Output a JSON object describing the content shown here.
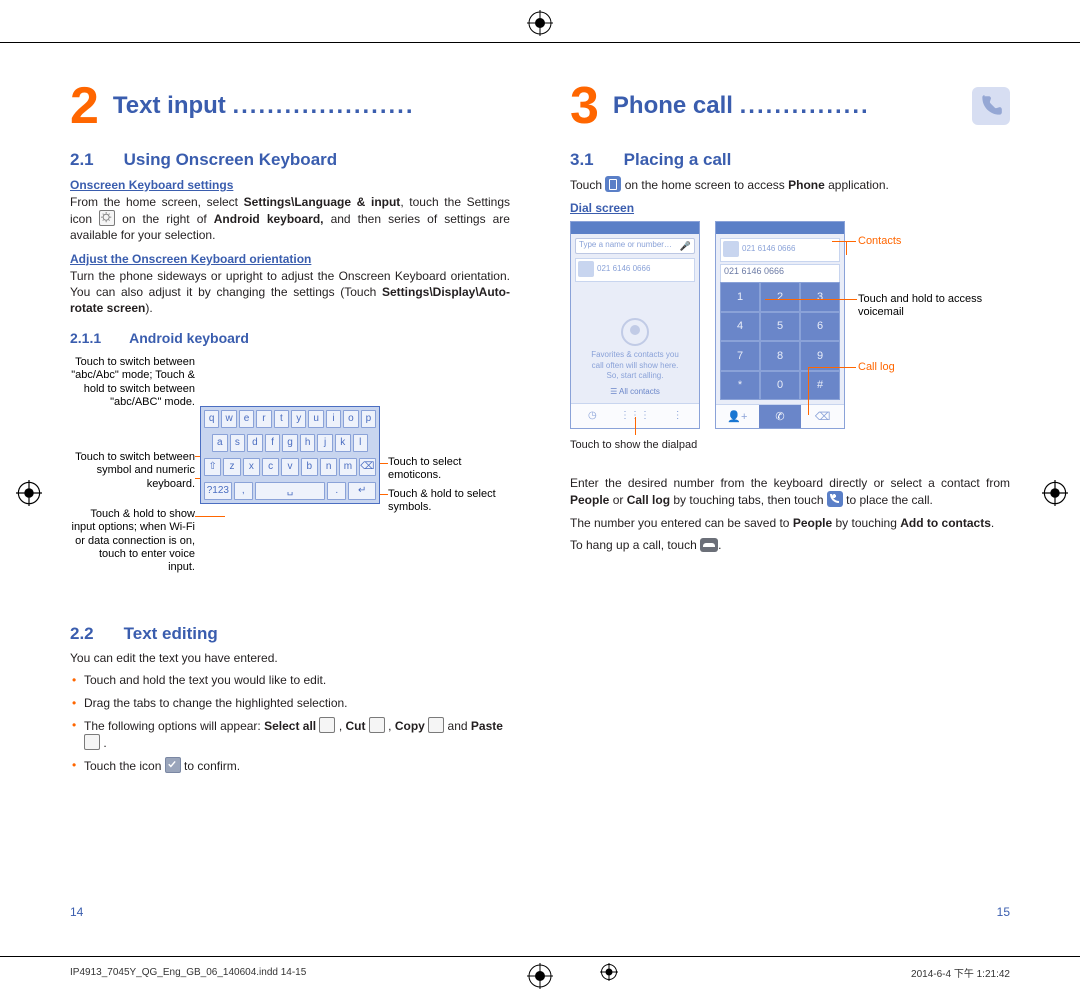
{
  "left": {
    "chapter_num": "2",
    "chapter_title": "Text input",
    "h21_num": "2.1",
    "h21_title": "Using Onscreen Keyboard",
    "sub1": "Onscreen Keyboard settings",
    "p1a": "From the home screen, select ",
    "p1b": "Settings\\Language & input",
    "p1c": ", touch the Settings icon ",
    "p1d": " on the right of ",
    "p1e": "Android keyboard,",
    "p1f": " and then series of settings are available for your selection.",
    "sub2": "Adjust the Onscreen Keyboard orientation",
    "p2a": "Turn the phone sideways or upright to adjust the Onscreen Keyboard orientation. You can also adjust it by changing the settings (Touch ",
    "p2b": "Settings\\Display\\Auto-rotate screen",
    "p2c": ").",
    "h211_num": "2.1.1",
    "h211_title": "Android keyboard",
    "kb_l1": "Touch to switch between \"abc/Abc\" mode; Touch & hold to switch between \"abc/ABC\" mode.",
    "kb_l2": "Touch to switch between symbol and numeric keyboard.",
    "kb_l3": "Touch & hold to show input options; when Wi-Fi or data connection is on, touch to enter voice input.",
    "kb_r1": "Touch to select emoticons.",
    "kb_r2": "Touch & hold to select symbols.",
    "kb_rows": [
      [
        "q",
        "w",
        "e",
        "r",
        "t",
        "y",
        "u",
        "i",
        "o",
        "p"
      ],
      [
        "a",
        "s",
        "d",
        "f",
        "g",
        "h",
        "j",
        "k",
        "l"
      ],
      [
        "⇧",
        "z",
        "x",
        "c",
        "v",
        "b",
        "n",
        "m",
        "⌫"
      ],
      [
        "?123",
        ",",
        "␣",
        ".",
        "↵"
      ]
    ],
    "h22_num": "2.2",
    "h22_title": "Text editing",
    "p3": "You can edit the text you have entered.",
    "b1": "Touch and hold the text you would like to edit.",
    "b2": "Drag the tabs to change the highlighted selection.",
    "b3a": "The following options will appear: ",
    "b3b": "Select all",
    "b3c": " , ",
    "b3d": "Cut",
    "b3e": " , ",
    "b3f": "Copy",
    "b3g": " and ",
    "b3h": "Paste",
    "b3i": " .",
    "b4a": "Touch the icon ",
    "b4b": " to confirm.",
    "pagenum": "14"
  },
  "right": {
    "chapter_num": "3",
    "chapter_title": "Phone call",
    "h31_num": "3.1",
    "h31_title": "Placing a call",
    "p1a": "Touch ",
    "p1b": " on the home screen to access ",
    "p1c": "Phone",
    "p1d": " application.",
    "sub1": "Dial screen",
    "lbl_contacts": "Contacts",
    "lbl_voicemail": "Touch and hold to access voicemail",
    "lbl_calllog": "Call log",
    "lbl_dialpad": "Touch to show the dialpad",
    "search_ph": "Type a name or number…",
    "contact_num": "021 6146 0666",
    "fav_text1": "Favorites & contacts you",
    "fav_text2": "call often will show here.",
    "fav_text3": "So, start calling.",
    "all_contacts": "All contacts",
    "keys": [
      "1",
      "2",
      "3",
      "4",
      "5",
      "6",
      "7",
      "8",
      "9",
      "*",
      "0",
      "#"
    ],
    "p2a": "Enter the desired number from the keyboard directly or select a contact from ",
    "p2b": "People",
    "p2c": " or ",
    "p2d": "Call log",
    "p2e": " by touching tabs, then touch ",
    "p2f": " to place the call.",
    "p3a": "The number you entered can be saved to ",
    "p3b": "People",
    "p3c": " by touching ",
    "p3d": "Add to contacts",
    "p3e": ".",
    "p4a": "To hang up a call, touch ",
    "p4b": ".",
    "pagenum": "15"
  },
  "footer": {
    "file": "IP4913_7045Y_QG_Eng_GB_06_140604.indd   14-15",
    "date": "2014-6-4   下午 1:21:42"
  }
}
